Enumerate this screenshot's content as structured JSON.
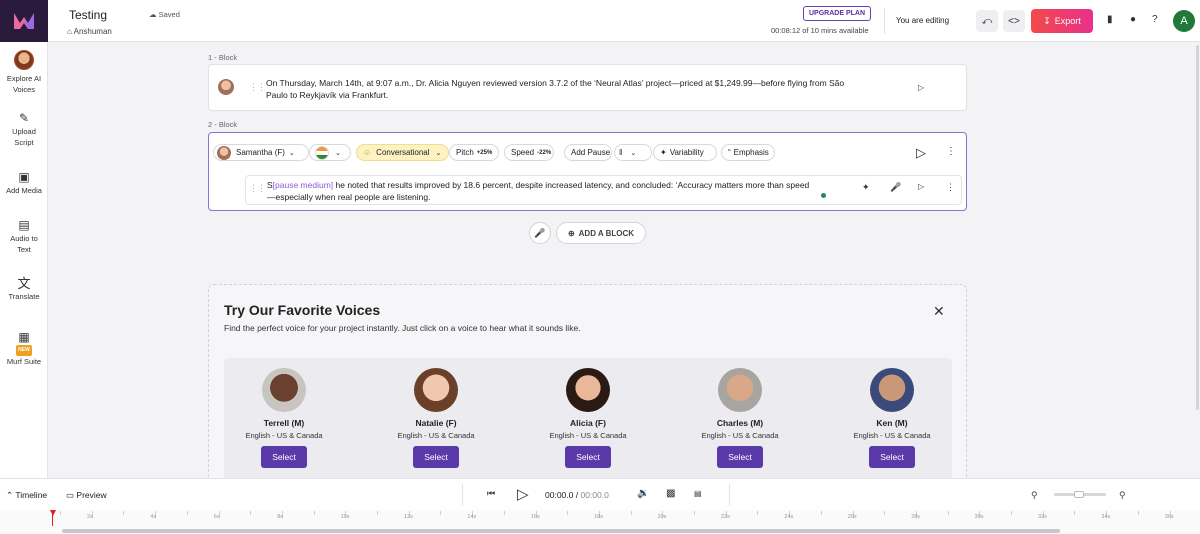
{
  "sidebar": {
    "items": [
      {
        "label1": "Explore AI",
        "label2": "Voices"
      },
      {
        "label1": "Upload",
        "label2": "Script"
      },
      {
        "label1": "Add Media",
        "label2": ""
      },
      {
        "label1": "Audio to",
        "label2": "Text"
      },
      {
        "label1": "Translate",
        "label2": ""
      },
      {
        "label1": "Murf Suite",
        "label2": "",
        "badge": "NEW"
      }
    ]
  },
  "header": {
    "project_title": "Testing",
    "saved_status": "Saved",
    "owner": "Anshuman",
    "upgrade_label": "UPGRADE PLAN",
    "minutes_status": "00:08:12 of 10 mins available",
    "editing_status": "You are editing",
    "export_label": "Export",
    "user_initial": "A"
  },
  "blocks": [
    {
      "label": "1 -  Block",
      "text": "On Thursday, March 14th, at 9:07 a.m., Dr. Alicia Nguyen reviewed version 3.7.2 of the ‘Neural Atlas’ project—priced at $1,249.99—before flying from São Paulo to Reykjavík via Frankfurt."
    },
    {
      "label": "2 -  Block",
      "voice": "Samantha (F)",
      "style": "Conversational",
      "pitch_label": "Pitch",
      "pitch_value": "+25%",
      "speed_label": "Speed",
      "speed_value": "-22%",
      "add_pause": "Add Pause",
      "variability": "Variability",
      "emphasis": "Emphasis",
      "text_first": "S",
      "pause_tag": "[pause medium]",
      "text_rest": " he noted that results improved by 18.6 percent, despite increased latency, and concluded: ‘Accuracy matters more than speed—especially when real people are listening."
    }
  ],
  "add_block_label": "ADD A BLOCK",
  "favorites": {
    "title": "Try Our Favorite Voices",
    "description": "Find the perfect voice for your project instantly. Just click on a voice to hear what it sounds like.",
    "select_label": "Select",
    "voices": [
      {
        "name": "Terrell (M)",
        "lang": "English - US & Canada"
      },
      {
        "name": "Natalie (F)",
        "lang": "English - US & Canada"
      },
      {
        "name": "Alicia (F)",
        "lang": "English - US & Canada"
      },
      {
        "name": "Charles (M)",
        "lang": "English - US & Canada"
      },
      {
        "name": "Ken (M)",
        "lang": "English - US & Canada"
      }
    ]
  },
  "timeline": {
    "timeline_label": "Timeline",
    "preview_label": "Preview",
    "current_time": "00:00.0",
    "total_time": "00:00.0",
    "ticks": [
      "2s",
      "4s",
      "6s",
      "8s",
      "10s",
      "12s",
      "14s",
      "16s",
      "18s",
      "20s",
      "22s",
      "24s",
      "26s",
      "28s",
      "30s",
      "32s",
      "34s",
      "36s"
    ]
  }
}
